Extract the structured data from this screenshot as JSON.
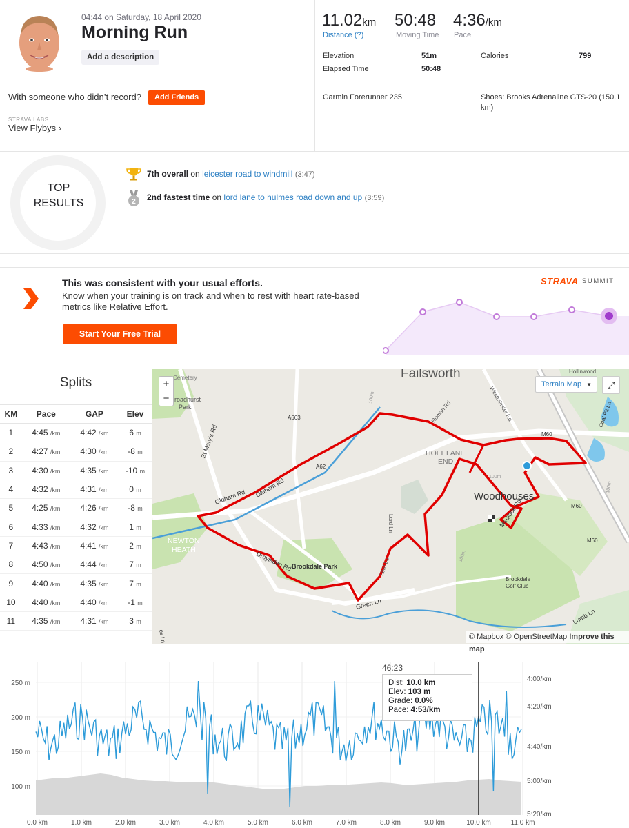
{
  "activity": {
    "datetime": "04:44 on Saturday, 18 April 2020",
    "title": "Morning Run",
    "add_description": "Add a description",
    "with_someone": "With someone who didn’t record?",
    "add_friends": "Add Friends",
    "labs_label": "STRAVA LABS",
    "view_flybys": "View Flybys ›"
  },
  "stats": {
    "distance_value": "11.02",
    "distance_unit": "km",
    "distance_label": "Distance (?)",
    "moving_time_value": "50:48",
    "moving_time_label": "Moving Time",
    "pace_value": "4:36",
    "pace_unit": "/km",
    "pace_label": "Pace",
    "elevation_label": "Elevation",
    "elevation_value": "51m",
    "calories_label": "Calories",
    "calories_value": "799",
    "elapsed_label": "Elapsed Time",
    "elapsed_value": "50:48",
    "device": "Garmin Forerunner 235",
    "shoes": "Shoes: Brooks Adrenaline GTS-20 (150.1",
    "shoes_cont": "km)"
  },
  "top_results": {
    "line1": "TOP",
    "line2": "RESULTS",
    "items": [
      {
        "rank": "7th overall",
        "on": "on",
        "segment": "leicester road to windmill",
        "time": "(3:47)"
      },
      {
        "rank": "2nd fastest time",
        "on": "on",
        "segment": "lord lane to hulmes road down and up",
        "time": "(3:59)"
      }
    ]
  },
  "promo": {
    "heading": "This was consistent with your usual efforts.",
    "body": "Know when your training is on track and when to rest with heart rate-based metrics like Relative Effort.",
    "button": "Start Your Free Trial",
    "brand": "STRAVA",
    "summit": "SUMMIT"
  },
  "splits": {
    "title": "Splits",
    "headers": [
      "KM",
      "Pace",
      "GAP",
      "Elev"
    ],
    "pace_unit": "/km",
    "elev_unit": "m",
    "rows": [
      {
        "km": "1",
        "pace": "4:45",
        "gap": "4:42",
        "elev": "6"
      },
      {
        "km": "2",
        "pace": "4:27",
        "gap": "4:30",
        "elev": "-8"
      },
      {
        "km": "3",
        "pace": "4:30",
        "gap": "4:35",
        "elev": "-10"
      },
      {
        "km": "4",
        "pace": "4:32",
        "gap": "4:31",
        "elev": "0"
      },
      {
        "km": "5",
        "pace": "4:25",
        "gap": "4:26",
        "elev": "-8"
      },
      {
        "km": "6",
        "pace": "4:33",
        "gap": "4:32",
        "elev": "1"
      },
      {
        "km": "7",
        "pace": "4:43",
        "gap": "4:41",
        "elev": "2"
      },
      {
        "km": "8",
        "pace": "4:50",
        "gap": "4:44",
        "elev": "7"
      },
      {
        "km": "9",
        "pace": "4:40",
        "gap": "4:35",
        "elev": "7"
      },
      {
        "km": "10",
        "pace": "4:40",
        "gap": "4:40",
        "elev": "-1"
      },
      {
        "km": "11",
        "pace": "4:35",
        "gap": "4:31",
        "elev": "3"
      }
    ]
  },
  "map": {
    "zoom_in": "+",
    "zoom_out": "−",
    "terrain_button": "Terrain Map",
    "attribution_1": "© Mapbox © OpenStreetMap",
    "attribution_2": "Improve this map",
    "places": {
      "failsworth": "Failsworth",
      "woodhouses": "Woodhouses",
      "holt_lane_end_1": "HOLT LANE",
      "holt_lane_end_2": "END",
      "newton_heath_1": "NEWTON",
      "newton_heath_2": "HEATH",
      "brookdale_park": "Brookdale Park",
      "brookdale_golf_1": "Brookdale",
      "brookdale_golf_2": "Golf Club",
      "broadhurst_park_1": "Broadhurst",
      "broadhurst_park_2": "Park",
      "cemetery": "Cemetery",
      "hollinwood": "Hollinwood"
    },
    "roads": {
      "oldham_rd_1": "Oldham Rd",
      "oldham_rd_2": "Oldham Rd",
      "st_marys": "St Mary's Rd",
      "a663": "A663",
      "a62": "A62",
      "roman_rd": "Roman Rd",
      "westminster_rd": "Westminster Rd",
      "m60_1": "M60",
      "m60_2": "M60",
      "m60_3": "M60",
      "medlock_rd": "Medlock Rd",
      "lord_ln": "Lord Ln",
      "lord_ln_2": "Lord Ln",
      "droylsden_rd": "Droylsden Rd",
      "green_ln": "Green Ln",
      "lumb_ln": "Lumb Ln",
      "coal_pit_ln": "Coal Pit Ln",
      "es_ln": "es Ln",
      "contour_100_1": "100m",
      "contour_100_2": "100m",
      "contour_100_3": "100m",
      "contour_100_4": "100m"
    }
  },
  "elevation_chart": {
    "y_ticks_left": [
      "250 m",
      "200 m",
      "150 m",
      "100 m"
    ],
    "y_ticks_right": [
      "4:00/km",
      "4:20/km",
      "4:40/km",
      "5:00/km",
      "5:20/km"
    ],
    "x_ticks": [
      "0.0 km",
      "1.0 km",
      "2.0 km",
      "3.0 km",
      "4.0 km",
      "5.0 km",
      "6.0 km",
      "7.0 km",
      "8.0 km",
      "9.0 km",
      "10.0 km",
      "11.0 km"
    ],
    "tooltip": {
      "time": "46:23",
      "dist_label": "Dist:",
      "dist_value": "10.0 km",
      "elev_label": "Elev:",
      "elev_value": "103 m",
      "grade_label": "Grade:",
      "grade_value": "0.0%",
      "pace_label": "Pace:",
      "pace_value": "4:53/km"
    },
    "colors": {
      "pace_line": "#2d9bd9",
      "elevation_fill": "#d7d7d7"
    }
  },
  "colors": {
    "accent": "#fc4c02",
    "link": "#2d80c4",
    "route": "#e00000"
  }
}
